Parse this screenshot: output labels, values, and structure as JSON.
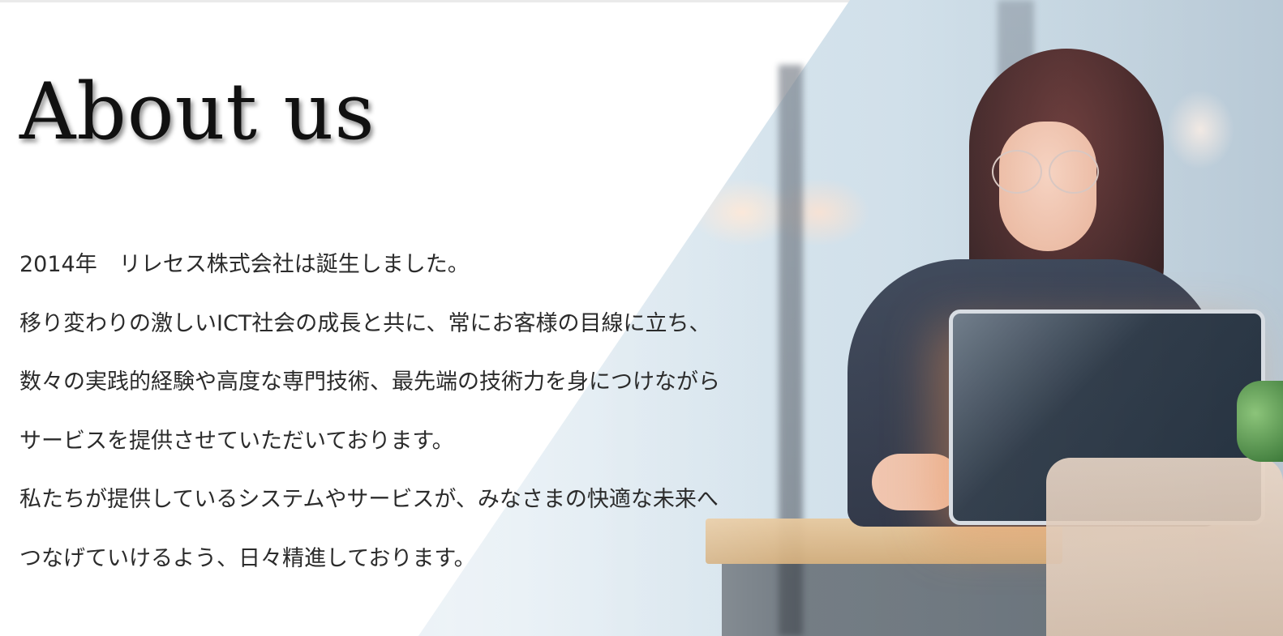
{
  "section": {
    "title": "About us",
    "paragraphs": [
      "2014年　リレセス株式会社は誕生しました。",
      "移り変わりの激しいICT社会の成長と共に、常にお客様の目線に立ち、",
      "数々の実践的経験や高度な専門技術、最先端の技術力を身につけながら",
      "サービスを提供させていただいております。",
      "私たちが提供しているシステムやサービスが、みなさまの快適な未来へ",
      "つなげていけるよう、日々精進しております。"
    ]
  },
  "image": {
    "subject": "woman-with-laptop-photo"
  },
  "colors": {
    "background": "#ffffff",
    "title": "#111111",
    "text": "#2b2b2b"
  }
}
